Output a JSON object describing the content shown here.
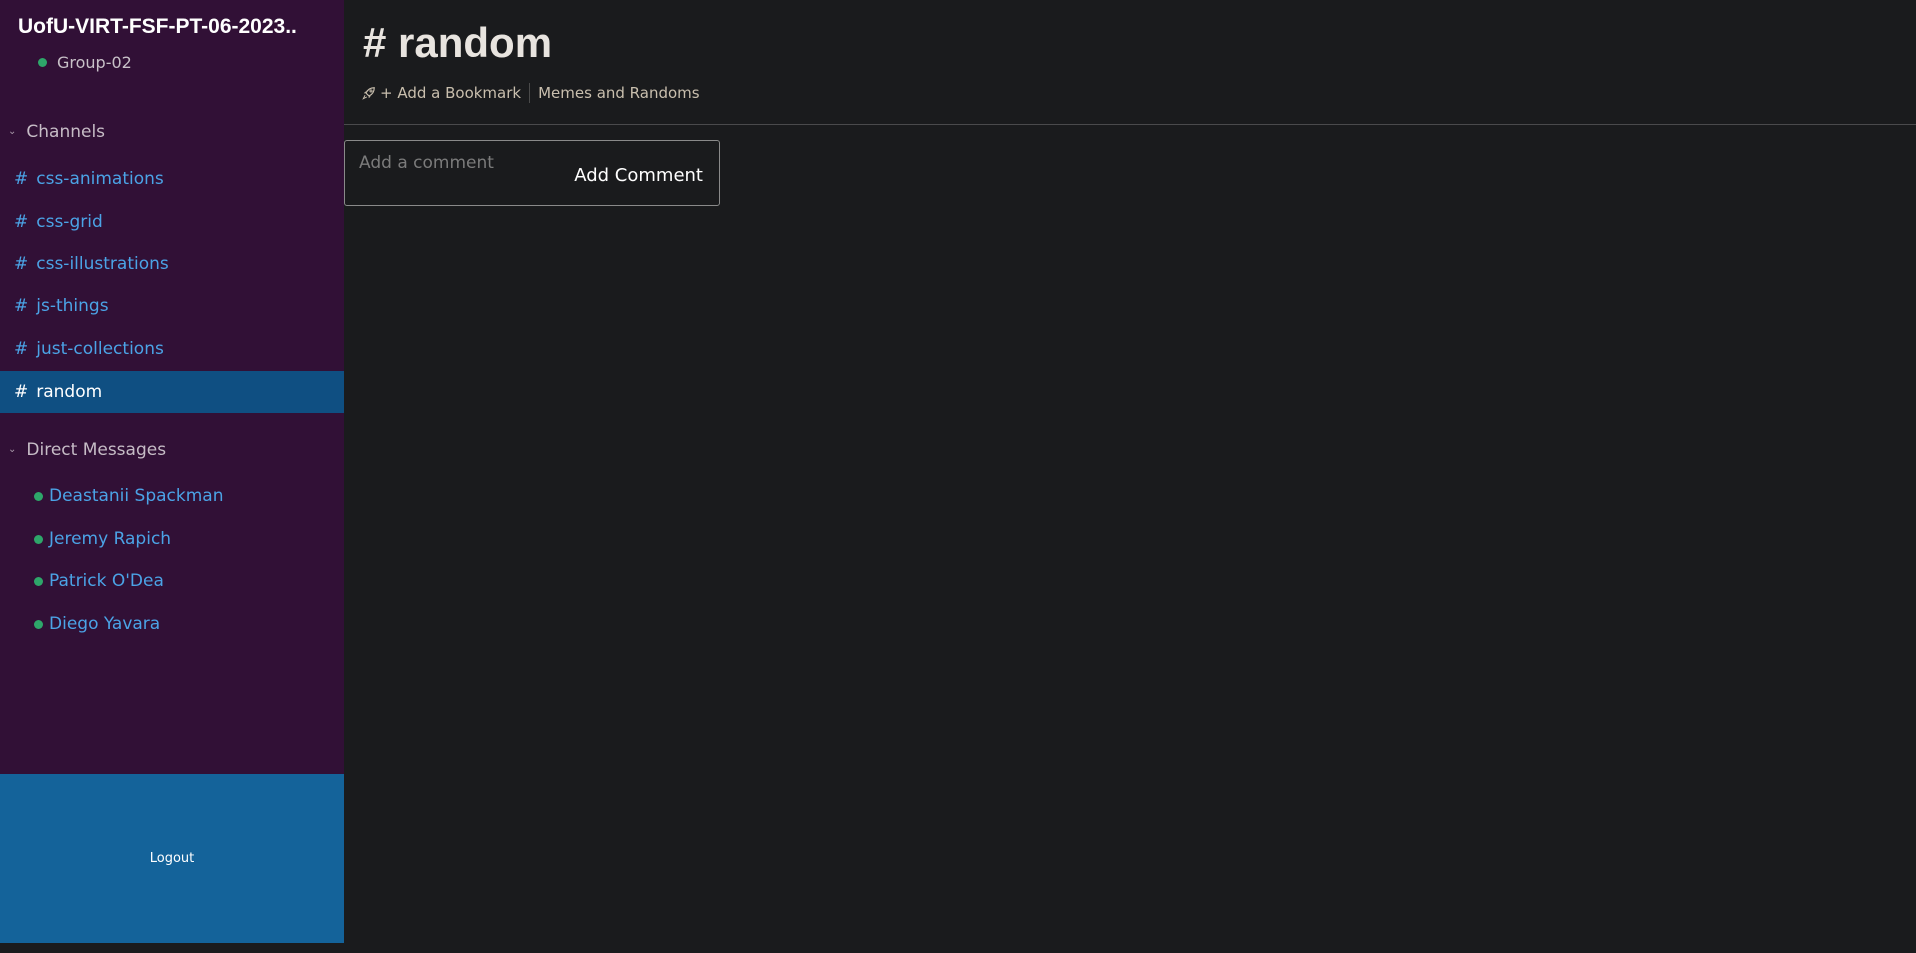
{
  "workspace": {
    "name": "UofU-VIRT-FSF-PT-06-2023..",
    "group": "Group-02"
  },
  "channels_section": {
    "label": "Channels",
    "items": [
      {
        "hash": "#",
        "name": "css-animations"
      },
      {
        "hash": "#",
        "name": "css-grid"
      },
      {
        "hash": "#",
        "name": "css-illustrations"
      },
      {
        "hash": "#",
        "name": "js-things"
      },
      {
        "hash": "#",
        "name": "just-collections"
      },
      {
        "hash": "#",
        "name": "random",
        "active": true
      }
    ]
  },
  "dm_section": {
    "label": "Direct Messages",
    "items": [
      {
        "name": "Deastanii Spackman"
      },
      {
        "name": "Jeremy Rapich"
      },
      {
        "name": "Patrick O'Dea"
      },
      {
        "name": "Diego Yavara"
      }
    ]
  },
  "logout": {
    "label": "Logout"
  },
  "main": {
    "title": "# random",
    "bookmark_add": "+ Add a Bookmark",
    "bookmark_link": "Memes and Randoms"
  },
  "comment": {
    "placeholder": "Add a comment",
    "button": "Add Comment"
  },
  "colors": {
    "sidebar_bg": "#311036",
    "active_channel_bg": "#0f4f82",
    "link": "#4ba3e6",
    "presence": "#2ea66a",
    "logout_bg": "#14639a",
    "main_bg": "#1a1b1d"
  },
  "icons": {
    "chevron": "chevron-down-icon",
    "presence": "presence-dot-icon",
    "bookmark": "rocket-icon"
  }
}
